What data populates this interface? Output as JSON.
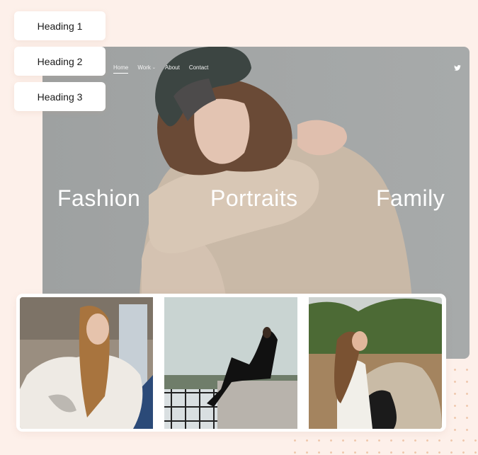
{
  "background_color": "#fdf0ea",
  "heading_buttons": [
    {
      "label": "Heading 1"
    },
    {
      "label": "Heading 2"
    },
    {
      "label": "Heading 3"
    }
  ],
  "site": {
    "nav": [
      {
        "label": "Home",
        "active": true
      },
      {
        "label": "Work",
        "dropdown": true,
        "chevron": "chevron-down-icon"
      },
      {
        "label": "About"
      },
      {
        "label": "Contact"
      }
    ],
    "social_icon": "twitter-icon",
    "hero_image": "woman in beige sweatshirt and dark cap",
    "categories": [
      "Fashion",
      "Portraits",
      "Family"
    ]
  },
  "gallery": {
    "images": [
      {
        "description": "woman in white sweater sitting in car"
      },
      {
        "description": "woman in black dress sitting on concrete wall"
      },
      {
        "description": "woman with long hair sitting by rock outdoors"
      }
    ]
  }
}
